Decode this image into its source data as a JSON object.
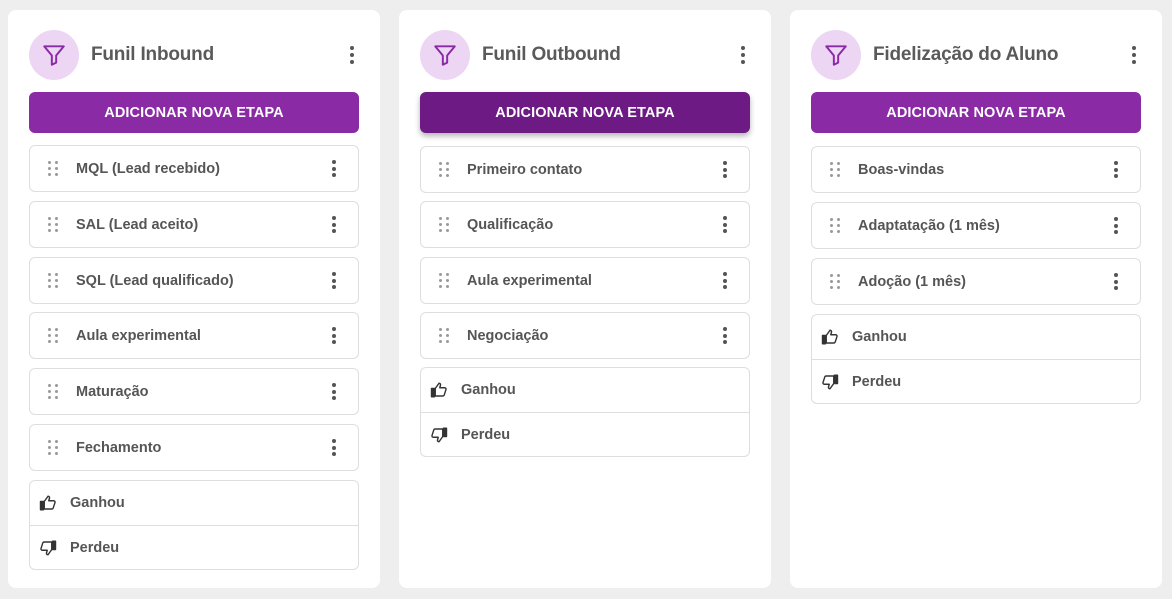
{
  "colors": {
    "accent": "#8a2aa5",
    "accent_active": "#6d1a84",
    "icon_bg": "#ecd6f4"
  },
  "funnels": [
    {
      "title": "Funil Inbound",
      "icon": "funnel-icon",
      "add_label": "ADICIONAR NOVA ETAPA",
      "stages": [
        "MQL (Lead recebido)",
        "SAL (Lead aceito)",
        "SQL (Lead qualificado)",
        "Aula experimental",
        "Maturação",
        "Fechamento"
      ],
      "won_label": "Ganhou",
      "lost_label": "Perdeu"
    },
    {
      "title": "Funil Outbound",
      "icon": "funnel-icon",
      "add_label": "ADICIONAR NOVA ETAPA",
      "stages": [
        "Primeiro contato",
        "Qualificação",
        "Aula experimental",
        "Negociação"
      ],
      "won_label": "Ganhou",
      "lost_label": "Perdeu"
    },
    {
      "title": "Fidelização do Aluno",
      "icon": "funnel-icon",
      "add_label": "ADICIONAR NOVA ETAPA",
      "stages": [
        "Boas-vindas",
        "Adaptatação (1 mês)",
        "Adoção (1 mês)"
      ],
      "won_label": "Ganhou",
      "lost_label": "Perdeu"
    }
  ]
}
